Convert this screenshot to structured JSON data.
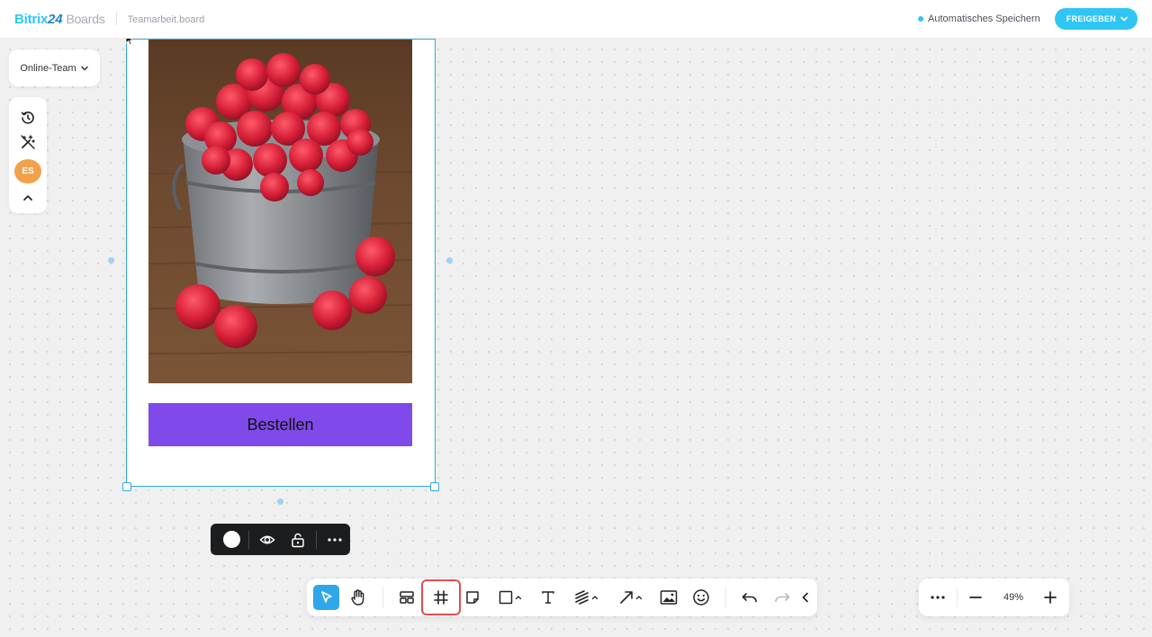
{
  "header": {
    "logo_part1": "Bitrix",
    "logo_part2": "24",
    "logo_part3": "Boards",
    "board_name": "Teamarbeit.board",
    "autosave_label": "Automatisches Speichern",
    "share_label": "FREIGEBEN"
  },
  "left_panel": {
    "team_selector": "Online-Team",
    "avatar_initials": "ES",
    "tools": [
      "history-icon",
      "magic-wand-off-icon",
      "user-avatar",
      "chevron-up-icon"
    ]
  },
  "card": {
    "button_label": "Bestellen",
    "image_description_icon": "raspberry-bucket-photo"
  },
  "context_toolbar": {
    "tools": [
      "color-swatch",
      "visibility-eye-icon",
      "unlock-icon",
      "more-icon"
    ]
  },
  "bottom_toolbar": {
    "tools": [
      "select-pointer",
      "hand-pan",
      "templates",
      "frame",
      "sticky-note",
      "shapes",
      "text",
      "pen",
      "arrow",
      "image",
      "emoji",
      "undo",
      "redo",
      "collapse"
    ],
    "active_tool": "select-pointer",
    "highlighted_tool": "frame"
  },
  "zoom": {
    "value": "49%"
  },
  "colors": {
    "accent": "#2fc6f6",
    "selection": "#2fa7e8",
    "card_button": "#7f4ae9",
    "avatar": "#f2a14b",
    "highlight_outline": "#e34d4d"
  }
}
